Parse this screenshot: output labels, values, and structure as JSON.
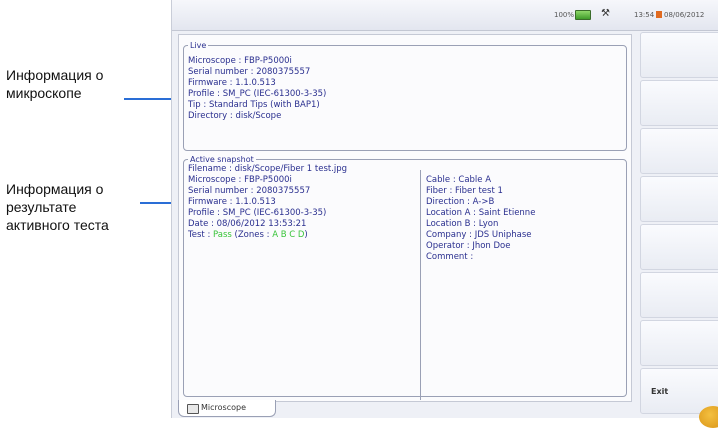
{
  "callouts": {
    "microscope_info": [
      "Информация о",
      "микроскопе"
    ],
    "active_test_info": [
      "Информация о",
      "результате",
      "активного теста"
    ]
  },
  "status_bar": {
    "battery_percent": "100%",
    "time": "13:54",
    "date": "08/06/2012"
  },
  "live": {
    "legend": "Live",
    "lines": [
      "Microscope : FBP-P5000i",
      "Serial number : 2080375557",
      "Firmware : 1.1.0.513",
      "Profile : SM_PC (IEC-61300-3-35)",
      "Tip : Standard Tips (with BAP1)",
      "Directory : disk/Scope"
    ]
  },
  "active_snapshot": {
    "legend": "Active snapshot",
    "filename": "Filename : disk/Scope/Fiber 1 test.jpg",
    "left_lines": [
      "Microscope : FBP-P5000i",
      "Serial number : 2080375557",
      "Firmware : 1.1.0.513",
      "Profile : SM_PC (IEC-61300-3-35)",
      "Date : 08/06/2012 13:53:21"
    ],
    "test_prefix": "Test : ",
    "test_result": "Pass",
    "zones_open": " (Zones : ",
    "zones": "A B C D",
    "zones_close": ")",
    "right_lines": [
      "Cable : Cable A",
      "Fiber : Fiber test 1",
      "Direction : A->B",
      "Location A : Saint Etienne",
      "Location B : Lyon",
      "Company : JDS Uniphase",
      "Operator : Jhon Doe",
      "Comment :"
    ]
  },
  "sidebar": {
    "exit_label": "Exit"
  },
  "tabs": [
    {
      "label": "Microscope"
    }
  ],
  "colors": {
    "accent_line": "#2a6ed6",
    "pass": "#39c43a",
    "text": "#2a2f8f"
  }
}
